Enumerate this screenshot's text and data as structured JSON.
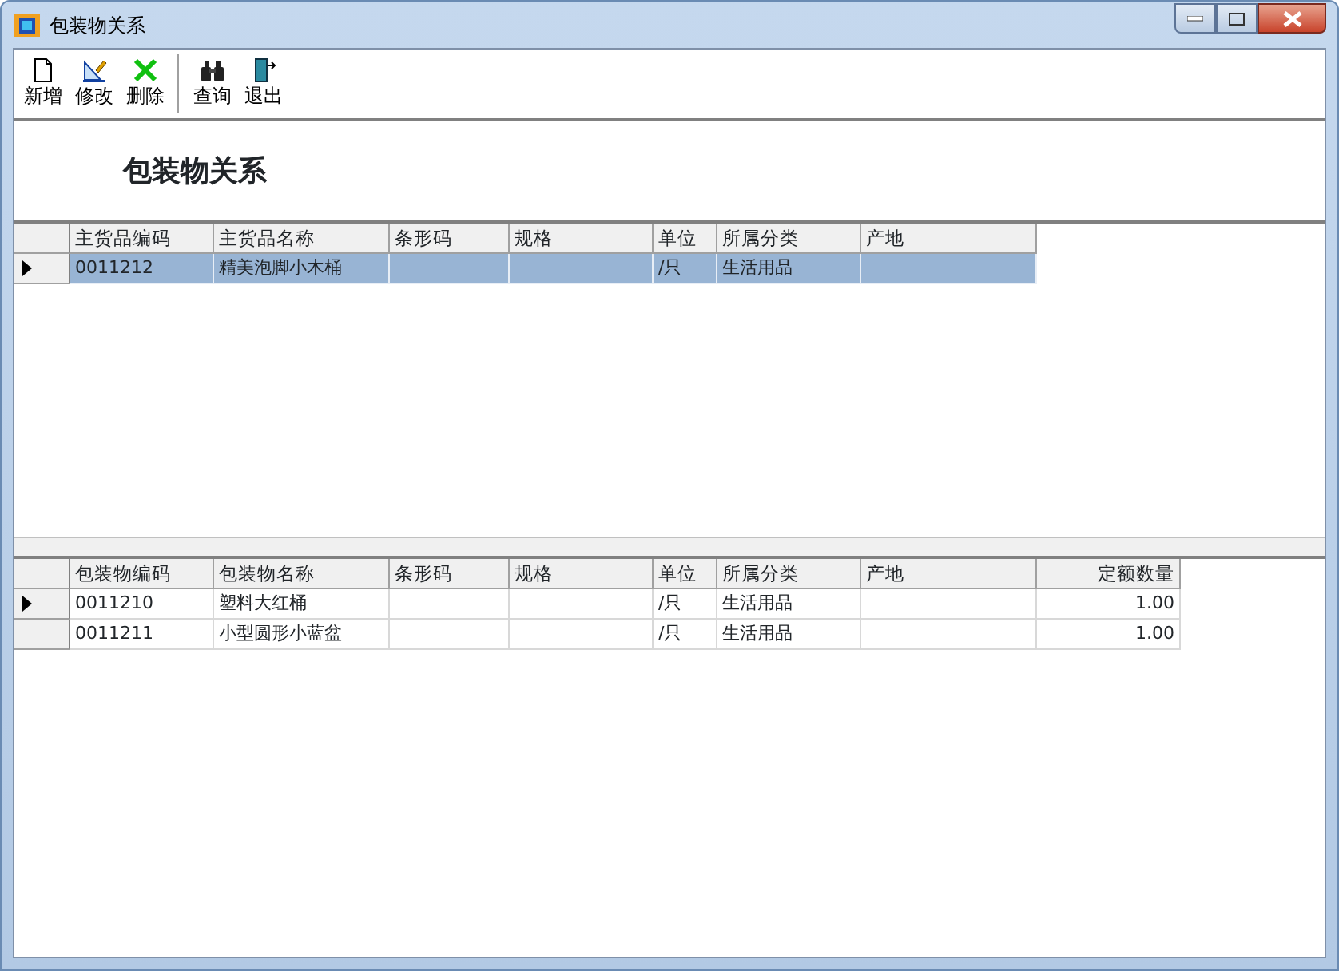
{
  "window": {
    "title": "包装物关系"
  },
  "toolbar": [
    {
      "kind": "new",
      "label": "新增"
    },
    {
      "kind": "edit",
      "label": "修改"
    },
    {
      "kind": "delete",
      "label": "删除"
    },
    {
      "kind": "separator"
    },
    {
      "kind": "search",
      "label": "查询"
    },
    {
      "kind": "exit",
      "label": "退出"
    }
  ],
  "heading": "包装物关系",
  "main_grid": {
    "columns": [
      {
        "label": "主货品编码",
        "kind": "text"
      },
      {
        "label": "主货品名称",
        "kind": "text"
      },
      {
        "label": "条形码",
        "kind": "text"
      },
      {
        "label": "规格",
        "kind": "text"
      },
      {
        "label": "单位",
        "kind": "text"
      },
      {
        "label": "所属分类",
        "kind": "text"
      },
      {
        "label": "产地",
        "kind": "text"
      }
    ],
    "rows": [
      {
        "current": true,
        "selected": true,
        "cells": [
          "0011212",
          "精美泡脚小木桶",
          "",
          "",
          "/只",
          "生活用品",
          ""
        ]
      }
    ]
  },
  "package_grid": {
    "columns": [
      {
        "label": "包装物编码",
        "kind": "text"
      },
      {
        "label": "包装物名称",
        "kind": "text"
      },
      {
        "label": "条形码",
        "kind": "text"
      },
      {
        "label": "规格",
        "kind": "text"
      },
      {
        "label": "单位",
        "kind": "text"
      },
      {
        "label": "所属分类",
        "kind": "text"
      },
      {
        "label": "产地",
        "kind": "text"
      },
      {
        "label": "定额数量",
        "kind": "number"
      }
    ],
    "rows": [
      {
        "current": true,
        "selected": false,
        "cells": [
          "0011210",
          "塑料大红桶",
          "",
          "",
          "/只",
          "生活用品",
          "",
          "1.00"
        ]
      },
      {
        "current": false,
        "selected": false,
        "cells": [
          "0011211",
          "小型圆形小蓝盆",
          "",
          "",
          "/只",
          "生活用品",
          "",
          "1.00"
        ]
      }
    ]
  }
}
